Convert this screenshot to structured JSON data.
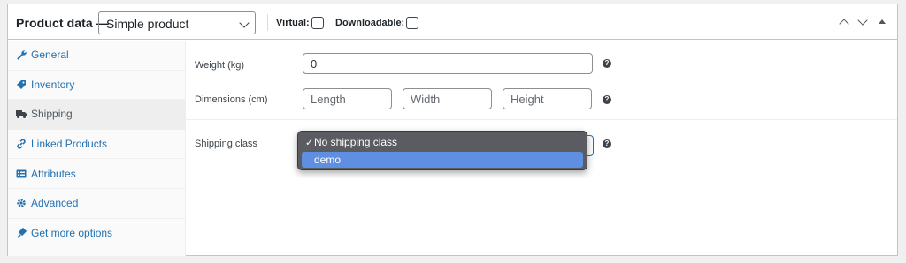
{
  "header": {
    "title": "Product data —",
    "product_type": "Simple product",
    "virtual_label": "Virtual:",
    "downloadable_label": "Downloadable:"
  },
  "sidebar": {
    "items": [
      {
        "label": "General",
        "icon": "wrench-icon"
      },
      {
        "label": "Inventory",
        "icon": "tag-icon"
      },
      {
        "label": "Shipping",
        "icon": "truck-icon",
        "active": true
      },
      {
        "label": "Linked Products",
        "icon": "link-icon"
      },
      {
        "label": "Attributes",
        "icon": "list-icon"
      },
      {
        "label": "Advanced",
        "icon": "gear-icon"
      },
      {
        "label": "Get more options",
        "icon": "plugin-icon"
      }
    ]
  },
  "shipping": {
    "weight_label": "Weight (kg)",
    "weight_value": "0",
    "dimensions_label": "Dimensions (cm)",
    "length_placeholder": "Length",
    "width_placeholder": "Width",
    "height_placeholder": "Height",
    "class_label": "Shipping class",
    "class_options": [
      {
        "label": "No shipping class",
        "selected": true
      },
      {
        "label": "demo",
        "highlighted": true
      }
    ],
    "check_mark": "✓",
    "help_glyph": "?"
  },
  "colors": {
    "link": "#2271b1",
    "highlight": "#5f8fe0",
    "dropdown_bg": "#5a5c61"
  }
}
